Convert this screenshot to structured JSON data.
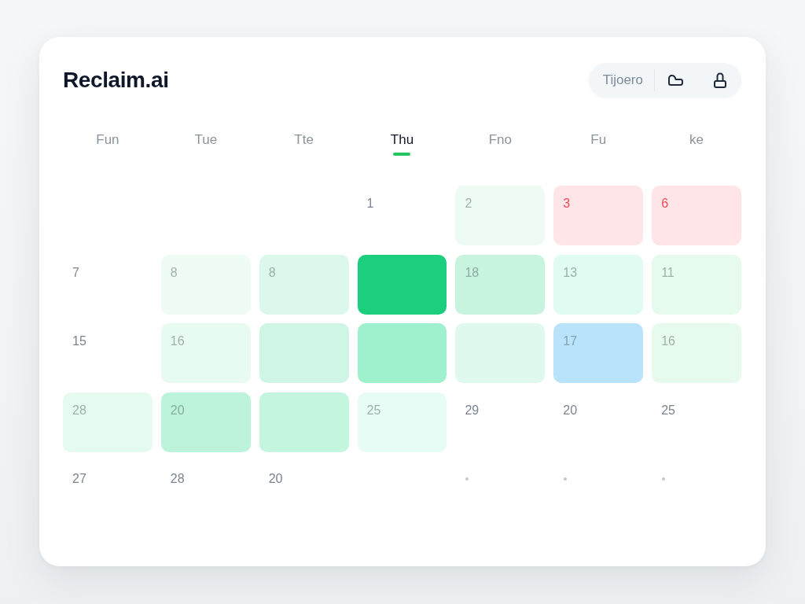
{
  "app": {
    "title": "Reclaim.ai"
  },
  "toolbar": {
    "label": "Tijoero"
  },
  "weekdays": [
    {
      "label": "Fun",
      "selected": false
    },
    {
      "label": "Tue",
      "selected": false
    },
    {
      "label": "Tte",
      "selected": false
    },
    {
      "label": "Thu",
      "selected": true
    },
    {
      "label": "Fno",
      "selected": false
    },
    {
      "label": "Fu",
      "selected": false
    },
    {
      "label": "ke",
      "selected": false
    }
  ],
  "weeks": [
    {
      "days": [
        {
          "kind": "blank"
        },
        {
          "kind": "blank"
        },
        {
          "kind": "blank"
        },
        {
          "kind": "plain",
          "day": "1"
        },
        {
          "kind": "tinted",
          "day": "2",
          "color": "#eefbf4"
        },
        {
          "kind": "alert",
          "day": "3",
          "color": "#ffe4e8"
        },
        {
          "kind": "alert",
          "day": "6",
          "color": "#ffe4e8"
        }
      ]
    },
    {
      "days": [
        {
          "kind": "plain",
          "day": "7"
        },
        {
          "kind": "tinted",
          "day": "8",
          "color": "#effbf5"
        },
        {
          "kind": "tinted",
          "day": "8",
          "color": "#dcf8ec"
        },
        {
          "kind": "tinted",
          "color": "#1ccf7f"
        },
        {
          "kind": "tinted",
          "day": "18",
          "color": "#c8f4df"
        },
        {
          "kind": "tinted",
          "day": "13",
          "color": "#e0fbf1"
        },
        {
          "kind": "tinted",
          "day": "11",
          "color": "#e6fbee"
        }
      ]
    },
    {
      "days": [
        {
          "kind": "plain",
          "day": "15"
        },
        {
          "kind": "tinted",
          "day": "16",
          "color": "#e8fbf0"
        },
        {
          "kind": "tinted",
          "color": "#cff6e4"
        },
        {
          "kind": "tinted",
          "color": "#9ff0cc"
        },
        {
          "kind": "tinted",
          "color": "#dff9ee"
        },
        {
          "kind": "tinted",
          "day": "17",
          "color": "#b9e3fb"
        },
        {
          "kind": "tinted",
          "day": "16",
          "color": "#e6fbee"
        }
      ]
    },
    {
      "days": [
        {
          "kind": "tinted",
          "day": "28",
          "color": "#e6fbf0"
        },
        {
          "kind": "tinted",
          "day": "20",
          "color": "#bdf3da"
        },
        {
          "kind": "tinted",
          "color": "#c4f5de"
        },
        {
          "kind": "tinted",
          "day": "25",
          "color": "#e6fcf4"
        },
        {
          "kind": "plain",
          "day": "29"
        },
        {
          "kind": "plain",
          "day": "20"
        },
        {
          "kind": "plain",
          "day": "25"
        }
      ]
    },
    {
      "days": [
        {
          "kind": "plain",
          "day": "27"
        },
        {
          "kind": "plain",
          "day": "28"
        },
        {
          "kind": "plain",
          "day": "20"
        },
        {
          "kind": "blank"
        },
        {
          "kind": "dot"
        },
        {
          "kind": "dot"
        },
        {
          "kind": "dot"
        }
      ]
    }
  ]
}
